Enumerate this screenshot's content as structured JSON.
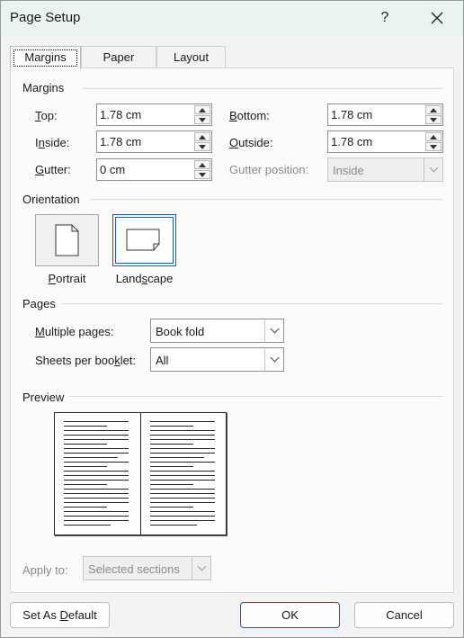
{
  "window": {
    "title": "Page Setup",
    "help_label": "?",
    "close_label": "✕"
  },
  "tabs": [
    {
      "label": "Margins"
    },
    {
      "label": "Paper"
    },
    {
      "label": "Layout"
    }
  ],
  "margins": {
    "section_title": "Margins",
    "top": {
      "label_u": "T",
      "label_rest": "op:",
      "value": "1.78 cm"
    },
    "inside": {
      "label_pre": "I",
      "label_u": "n",
      "label_rest": "side:",
      "value": "1.78 cm"
    },
    "gutter": {
      "label_u": "G",
      "label_rest": "utter:",
      "value": "0 cm"
    },
    "bottom": {
      "label_u": "B",
      "label_rest": "ottom:",
      "value": "1.78 cm"
    },
    "outside": {
      "label_u": "O",
      "label_rest": "utside:",
      "value": "1.78 cm"
    },
    "gutter_position": {
      "label": "Gutter position:",
      "value": "Inside"
    }
  },
  "orientation": {
    "section_title": "Orientation",
    "portrait": {
      "label_u": "P",
      "label_rest": "ortrait"
    },
    "landscape": {
      "label_pre": "Land",
      "label_u": "s",
      "label_rest": "cape"
    }
  },
  "pages": {
    "section_title": "Pages",
    "multiple_pages": {
      "label_u": "M",
      "label_rest": "ultiple pages:",
      "value": "Book fold"
    },
    "sheets_per_booklet": {
      "label_pre": "Sheets per boo",
      "label_u": "k",
      "label_rest": "let:",
      "value": "All"
    }
  },
  "preview": {
    "section_title": "Preview"
  },
  "apply_to": {
    "label": "Apply to:",
    "value": "Selected sections"
  },
  "buttons": {
    "set_default_pre": "Set As ",
    "set_default_u": "D",
    "set_default_rest": "efault",
    "ok": "OK",
    "cancel": "Cancel"
  },
  "colors": {
    "accent": "#0a5fbf",
    "titlebar_bg": "#e9f3f0"
  }
}
